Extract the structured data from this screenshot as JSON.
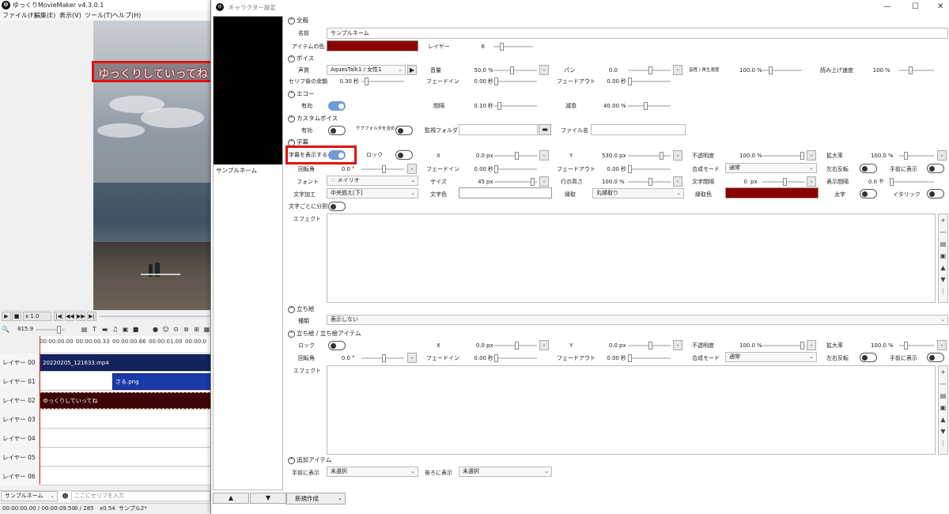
{
  "main_window": {
    "title": "ゆっくりMovieMaker v4.3.0.1",
    "menu": [
      "ファイル(F)",
      "編集(E)",
      "表示(V)",
      "ツール(T)",
      "ヘルプ(H)"
    ],
    "preview_subtitle": "ゆっくりしていってね",
    "transport": {
      "speed": "x 1.0",
      "zoom": "815.9"
    },
    "ruler_ticks": [
      "00:00:00.00",
      "00:00:00.33",
      "00:00:00.66",
      "00:00:01.00",
      "00:00:0"
    ],
    "layers": [
      "レイヤー 00",
      "レイヤー 01",
      "レイヤー 02",
      "レイヤー 03",
      "レイヤー 04",
      "レイヤー 05",
      "レイヤー 06"
    ],
    "clips": {
      "video": "20220205_121633.mp4",
      "image": "さる.png",
      "voice": "ゆっくりしていってね"
    },
    "character_select": "サンプルネーム",
    "dialogue_placeholder": "ここにセリフを入力",
    "status": {
      "time": "00:00:00.00 / 00:00:09.50",
      "frame": "0 / 285",
      "zoom": "x0.54",
      "project": "サンプル2*"
    }
  },
  "dialog": {
    "title": "キャラクター設定",
    "char_list_item": "サンプルネーム",
    "new_button": "新規作成",
    "up_arrow": "▲",
    "down_arrow": "▼",
    "sections": {
      "general": {
        "header": "全般",
        "name_label": "名前",
        "name_value": "サンプルネーム",
        "item_color_label": "アイテムの色",
        "item_color": "#8b0000",
        "layer_label": "レイヤー",
        "layer_value": "6"
      },
      "voice": {
        "header": "ボイス",
        "voice_label": "声質",
        "voice_value": "AquesTalk1 / 女性1",
        "volume_label": "音量",
        "volume_value": "50.0",
        "pan_label": "パン",
        "pan_value": "0.0",
        "playback_label": "音程 / 再生速度",
        "playback_value": "100.0",
        "read_speed_label": "読み上げ速度",
        "read_speed_value": "100",
        "after_label": "セリフ後の余韻",
        "after_value": "0.30",
        "fadein_label": "フェードイン",
        "fadein_value": "0.00",
        "fadeout_label": "フェードアウト",
        "fadeout_value": "0.00",
        "unit_pct": "%",
        "unit_sec": "秒"
      },
      "echo": {
        "header": "エコー",
        "enable_label": "有効",
        "interval_label": "間隔",
        "interval_value": "0.10",
        "decay_label": "減衰",
        "decay_value": "40.00"
      },
      "custom_voice": {
        "header": "カスタムボイス",
        "enable_label": "有効",
        "subfolder_label": "サブフォルダを含める",
        "watch_label": "監視フォルダ",
        "filename_label": "ファイル名"
      },
      "subtitle": {
        "header": "字幕",
        "show_label": "字幕を表示する",
        "lock_label": "ロック",
        "x_label": "X",
        "x_value": "0.0",
        "y_label": "Y",
        "y_value": "530.0",
        "opacity_label": "不透明度",
        "opacity_value": "100.0",
        "scale_label": "拡大率",
        "scale_value": "100.0",
        "rotation_label": "回転角",
        "rotation_value": "0.0",
        "fadein_label": "フェードイン",
        "fadein_value": "0.00",
        "fadeout_label": "フェードアウト",
        "fadeout_value": "0.00",
        "blend_label": "合成モード",
        "blend_value": "通常",
        "flip_label": "左右反転",
        "front_label": "手前に表示",
        "font_label": "フォント",
        "font_value": "メイリオ",
        "size_label": "サイズ",
        "size_value": "45",
        "line_height_label": "行の高さ",
        "line_height_value": "100.0",
        "letter_spacing_label": "文字間隔",
        "letter_spacing_value": "0",
        "display_interval_label": "表示間隔",
        "display_interval_value": "0.0",
        "char_deco_label": "文字加工",
        "char_deco_value": "中央揃え[下]",
        "text_color_label": "文字色",
        "border_label": "縁取",
        "border_value": "丸縁取り",
        "border_color_label": "縁取色",
        "border_color": "#8b0000",
        "bold_label": "太字",
        "italic_label": "イタリック",
        "split_label": "文字ごとに分割",
        "effect_label": "エフェクト",
        "unit_px": "px",
        "unit_pct": "%",
        "unit_sec": "秒",
        "unit_deg": "°"
      },
      "standing": {
        "header": "立ち絵",
        "type_label": "種類",
        "type_value": "表示しない"
      },
      "standing_item": {
        "header": "立ち絵 / 立ち絵アイテム",
        "lock_label": "ロック",
        "x_label": "X",
        "x_value": "0.0",
        "y_label": "Y",
        "y_value": "0.0",
        "opacity_label": "不透明度",
        "opacity_value": "100.0",
        "scale_label": "拡大率",
        "scale_value": "100.0",
        "rotation_label": "回転角",
        "rotation_value": "0.0",
        "fadein_label": "フェードイン",
        "fadein_value": "0.00",
        "fadeout_label": "フェードアウト",
        "fadeout_value": "0.00",
        "blend_label": "合成モード",
        "blend_value": "通常",
        "flip_label": "左右反転",
        "front_label": "手前に表示",
        "effect_label": "エフェクト"
      },
      "extra": {
        "header": "追加アイテム",
        "front_label": "手前に表示",
        "front_value": "未選択",
        "back_label": "後ろに表示",
        "back_value": "未選択"
      }
    }
  }
}
